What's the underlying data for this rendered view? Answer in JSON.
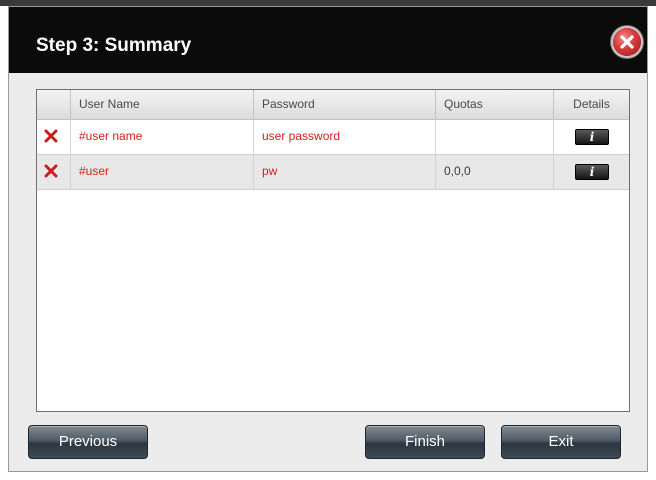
{
  "dialog": {
    "title": "Step 3: Summary"
  },
  "table": {
    "headers": {
      "user_name": "User Name",
      "password": "Password",
      "quotas": "Quotas",
      "details": "Details"
    },
    "rows": [
      {
        "user_name": "#user name",
        "password": "user password",
        "quotas": "",
        "details_icon": "info-icon"
      },
      {
        "user_name": "#user",
        "password": "pw",
        "quotas": "0,0,0",
        "details_icon": "info-icon"
      }
    ]
  },
  "buttons": {
    "previous": "Previous",
    "finish": "Finish",
    "exit": "Exit"
  },
  "icons": {
    "close": "close-icon",
    "delete": "delete-icon",
    "info": "i"
  },
  "colors": {
    "titlebar": "#0b0b0b",
    "row_text": "#d42020",
    "row_alt": "#e8e8e8",
    "button": "#4f5b66"
  }
}
